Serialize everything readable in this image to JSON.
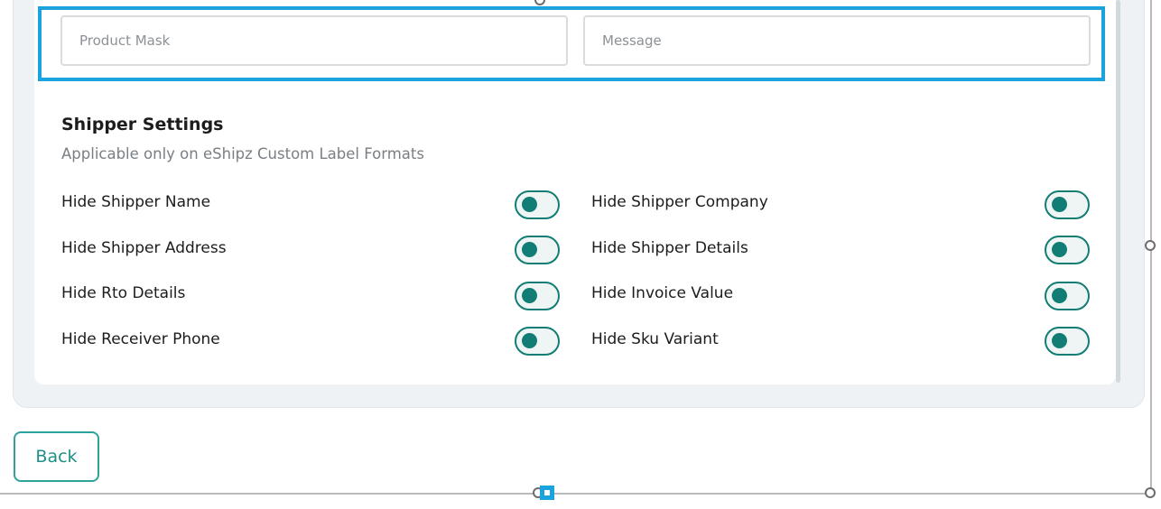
{
  "form": {
    "product_mask": {
      "value": "",
      "placeholder": "Product Mask"
    },
    "message": {
      "value": "",
      "placeholder": "Message"
    }
  },
  "shipper_settings": {
    "title": "Shipper Settings",
    "subtitle": "Applicable only on eShipz Custom Label Formats",
    "left": [
      {
        "label": "Hide Shipper Name",
        "enabled": true
      },
      {
        "label": "Hide Shipper Address",
        "enabled": true
      },
      {
        "label": "Hide Rto Details",
        "enabled": true
      },
      {
        "label": "Hide Receiver Phone",
        "enabled": true
      }
    ],
    "right": [
      {
        "label": "Hide Shipper Company",
        "enabled": true
      },
      {
        "label": "Hide Shipper Details",
        "enabled": true
      },
      {
        "label": "Hide Invoice Value",
        "enabled": true
      },
      {
        "label": "Hide Sku Variant",
        "enabled": true
      }
    ]
  },
  "actions": {
    "back_label": "Back"
  },
  "colors": {
    "accent": "#127d74",
    "selection": "#1aa3dd",
    "panel_bg": "#eef2f5"
  }
}
